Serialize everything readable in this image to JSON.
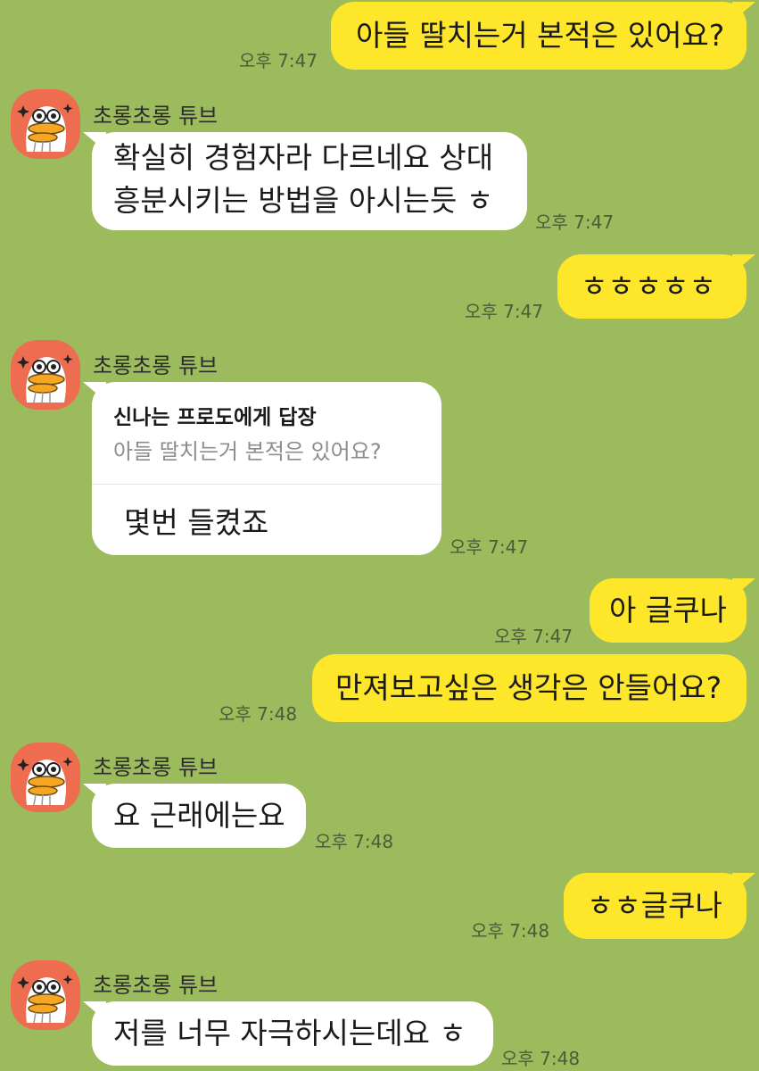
{
  "sender_name": "초롱초롱 튜브",
  "messages": [
    {
      "from": "me",
      "text": "아들 딸치는거 본적은 있어요?",
      "time": "오후 7:47"
    },
    {
      "from": "them",
      "lines": [
        "확실히 경험자라 다르네요 상대",
        "흥분시키는 방법을 아시는듯 ㅎ"
      ],
      "time": "오후 7:47"
    },
    {
      "from": "me",
      "text": "ㅎㅎㅎㅎㅎ",
      "time": "오후 7:47"
    },
    {
      "from": "them",
      "reply_to": "신나는 프로도에게 답장",
      "quote": "아들 딸치는거 본적은 있어요?",
      "text": "몇번 들켰죠",
      "time": "오후 7:47"
    },
    {
      "from": "me",
      "text": "아 글쿠나",
      "time": "오후 7:47"
    },
    {
      "from": "me",
      "text": "만져보고싶은 생각은 안들어요?",
      "time": "오후 7:48"
    },
    {
      "from": "them",
      "text": "요 근래에는요",
      "time": "오후 7:48"
    },
    {
      "from": "me",
      "text": "ㅎㅎ글쿠나",
      "time": "오후 7:48"
    },
    {
      "from": "them",
      "text": "저를 너무 자극하시는데요 ㅎ",
      "time": "오후 7:48"
    }
  ],
  "colors": {
    "background": "#9bbb5c",
    "my_bubble": "#fee62a",
    "their_bubble": "#ffffff",
    "avatar": "#ee6c50"
  }
}
